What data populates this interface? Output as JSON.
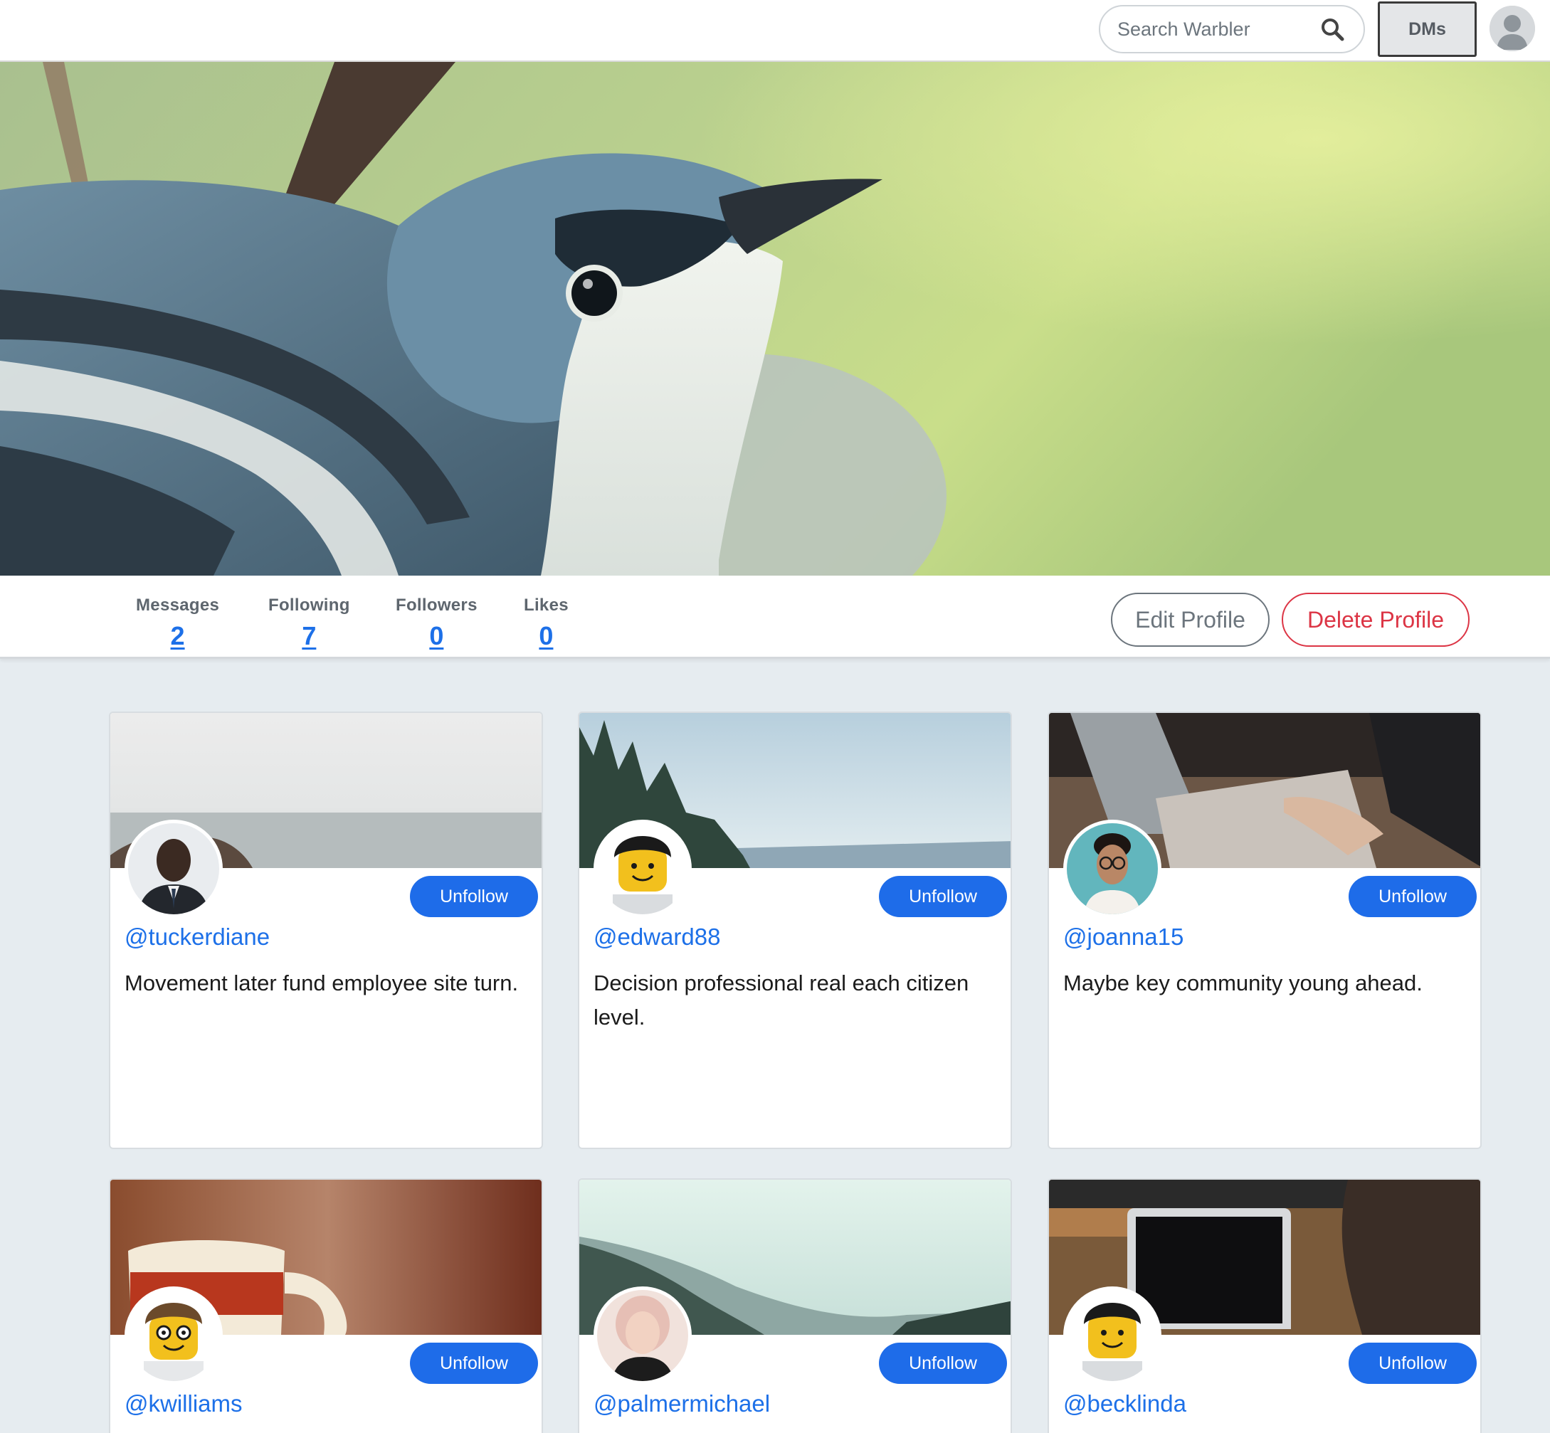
{
  "nav": {
    "search_placeholder": "Search Warbler",
    "dms_label": "DMs",
    "icons": {
      "search": "search-icon",
      "avatar": "user-avatar-icon"
    }
  },
  "profile": {
    "stats": [
      {
        "label": "Messages",
        "value": "2"
      },
      {
        "label": "Following",
        "value": "7"
      },
      {
        "label": "Followers",
        "value": "0"
      },
      {
        "label": "Likes",
        "value": "0"
      }
    ],
    "edit_label": "Edit Profile",
    "delete_label": "Delete Profile"
  },
  "following": [
    {
      "username": "@tuckerdiane",
      "bio": "Movement later fund employee site turn.",
      "button": "Unfollow"
    },
    {
      "username": "@edward88",
      "bio": "Decision professional real each citizen level.",
      "button": "Unfollow"
    },
    {
      "username": "@joanna15",
      "bio": "Maybe key community young ahead.",
      "button": "Unfollow"
    },
    {
      "username": "@kwilliams",
      "bio": "",
      "button": "Unfollow"
    },
    {
      "username": "@palmermichael",
      "bio": "",
      "button": "Unfollow"
    },
    {
      "username": "@becklinda",
      "bio": "",
      "button": "Unfollow"
    }
  ],
  "colors": {
    "accent": "#1e6ce9",
    "link": "#1d70e8",
    "danger": "#dc3545",
    "page_bg": "#e6ecf0"
  }
}
